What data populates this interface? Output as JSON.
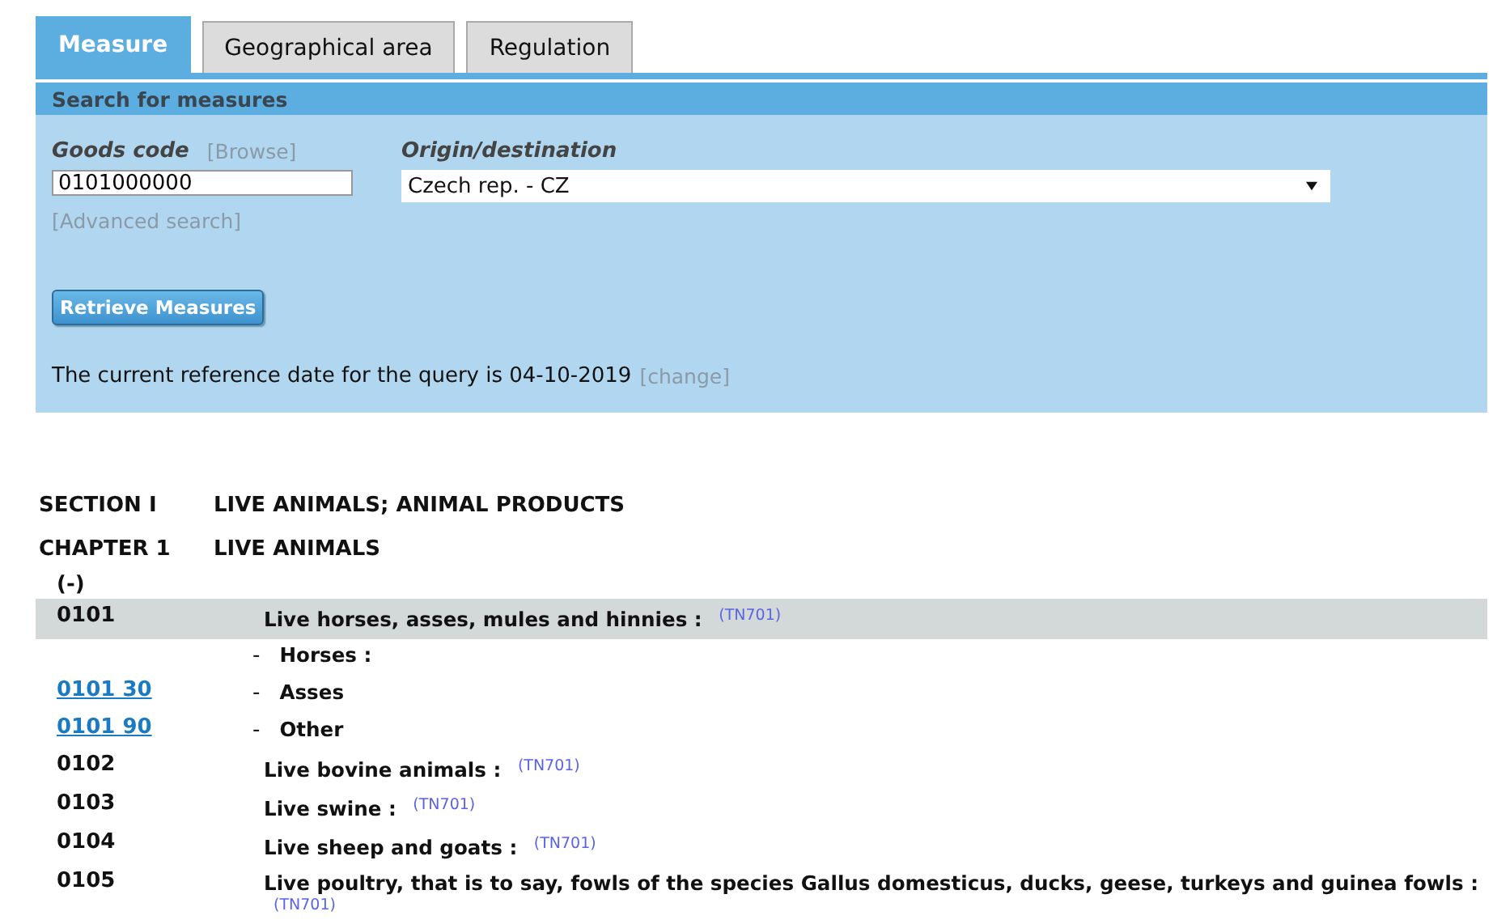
{
  "tabs": [
    {
      "label": "Measure",
      "selected": true
    },
    {
      "label": "Geographical area",
      "selected": false
    },
    {
      "label": "Regulation",
      "selected": false
    }
  ],
  "search_panel": {
    "title": "Search for measures",
    "goods_code": {
      "label": "Goods code",
      "browse_link": "[Browse]",
      "value": "0101000000"
    },
    "origin_destination": {
      "label": "Origin/destination",
      "value": "Czech rep. - CZ"
    },
    "advanced_search_link": "[Advanced search]",
    "button": "Retrieve Measures",
    "reference_date": {
      "text": "The current reference date for the query is 04-10-2019",
      "change_link": "[change]"
    }
  },
  "nomenclature": {
    "section": {
      "code": "SECTION I",
      "title": "LIVE ANIMALS; ANIMAL PRODUCTS"
    },
    "chapter": {
      "code": "CHAPTER 1",
      "title": "LIVE ANIMALS"
    },
    "collapse_toggle": "(-)",
    "rows": [
      {
        "code": "0101",
        "link": false,
        "selected": true,
        "description": "Live horses, asses, mules and hinnies :",
        "note": "(TN701)",
        "children": [
          {
            "dash": "-",
            "description": "Horses :"
          },
          {
            "code": "0101 30",
            "link": true,
            "dash": "-",
            "description": "Asses"
          },
          {
            "code": "0101 90",
            "link": true,
            "dash": "-",
            "description": "Other"
          }
        ]
      },
      {
        "code": "0102",
        "link": false,
        "selected": false,
        "description": "Live bovine animals :",
        "note": "(TN701)"
      },
      {
        "code": "0103",
        "link": false,
        "selected": false,
        "description": "Live swine :",
        "note": "(TN701)"
      },
      {
        "code": "0104",
        "link": false,
        "selected": false,
        "description": "Live sheep and goats :",
        "note": "(TN701)"
      },
      {
        "code": "0105",
        "link": false,
        "selected": false,
        "description": "Live poultry, that is to say, fowls of the species Gallus domesticus, ducks, geese, turkeys and guinea fowls :",
        "note": "(TN701)"
      }
    ]
  }
}
